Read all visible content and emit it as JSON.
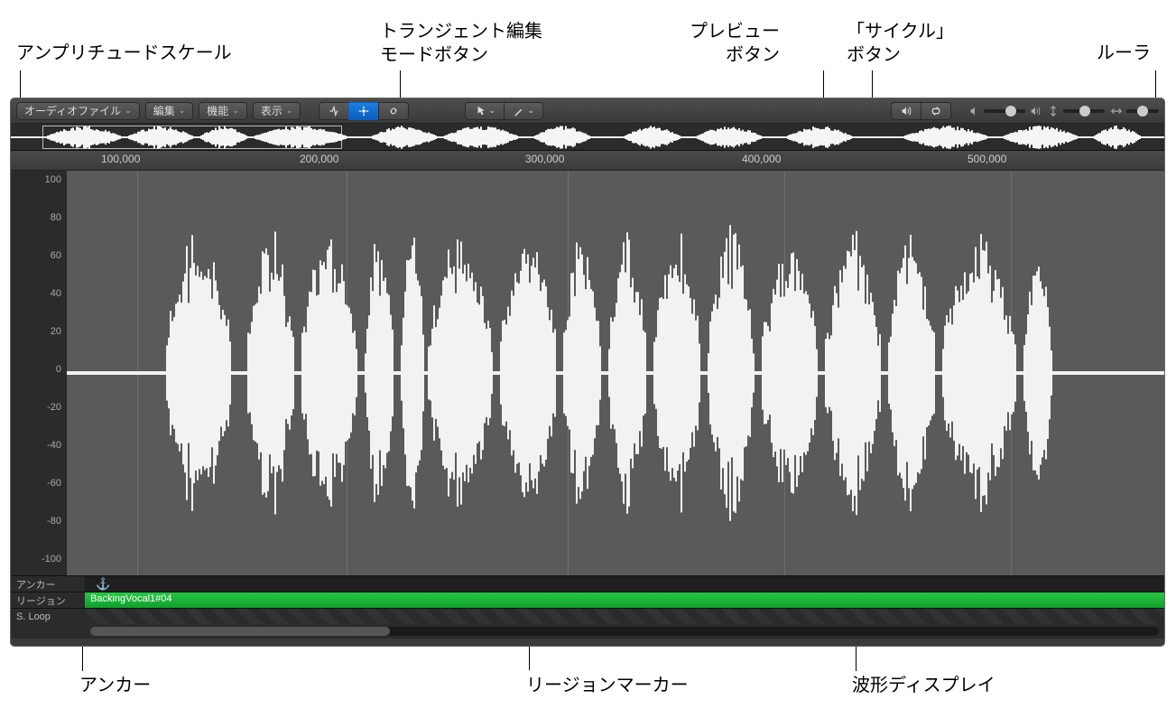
{
  "callouts": {
    "amplitude_scale": "アンプリチュードスケール",
    "transient_edit_mode": "トランジェント編集\nモードボタン",
    "preview_button": "プレビュー\nボタン",
    "cycle_button": "「サイクル」\nボタン",
    "ruler": "ルーラ",
    "anchor": "アンカー",
    "region_marker": "リージョンマーカー",
    "waveform_display": "波形ディスプレイ"
  },
  "toolbar": {
    "audio_file": "オーディオファイル",
    "edit": "編集",
    "functions": "機能",
    "view": "表示"
  },
  "ruler_ticks": [
    "100,000",
    "200,000",
    "300,000",
    "400,000",
    "500,000"
  ],
  "amplitude_ticks": [
    "100",
    "80",
    "60",
    "40",
    "20",
    "0",
    "-20",
    "-40",
    "-60",
    "-80",
    "-100"
  ],
  "bottom": {
    "anchor_label": "アンカー",
    "region_label": "リージョン",
    "loop_label": "S. Loop",
    "region_name": "BackingVocal1#04"
  },
  "icons": {
    "transient": "transient-icon",
    "flex": "flex-icon",
    "link": "link-icon",
    "pointer": "pointer-icon",
    "pencil": "pencil-icon",
    "speaker": "speaker-icon",
    "cycle": "cycle-icon",
    "vol_low": "volume-low-icon",
    "vol_hi": "volume-high-icon",
    "vzoom": "vertical-zoom-icon",
    "hzoom": "horizontal-zoom-icon"
  }
}
